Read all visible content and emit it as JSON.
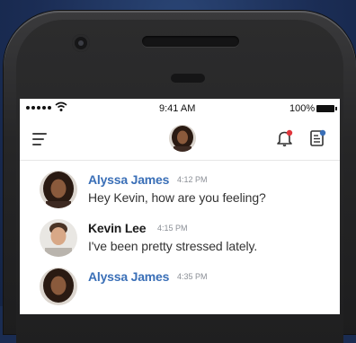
{
  "status_bar": {
    "time": "9:41 AM",
    "battery": "100%",
    "signal_icon": "signal-dots-icon",
    "wifi_icon": "wifi-icon",
    "battery_icon": "battery-icon"
  },
  "nav": {
    "menu_icon": "hamburger-icon",
    "avatar_icon": "avatar",
    "notification_icon": "bell-icon",
    "notes_icon": "notes-icon"
  },
  "colors": {
    "sender_blue": "#3a6fb7",
    "sender_dark": "#1b1b1b",
    "notification_dot": "#e0353b",
    "notes_dot": "#3a6fb7"
  },
  "messages": [
    {
      "name": "Alyssa James",
      "time": "4:12 PM",
      "text": "Hey Kevin, how are you feeling?"
    },
    {
      "name": "Kevin Lee",
      "time": "4:15 PM",
      "text": "I've been pretty stressed lately."
    },
    {
      "name": "Alyssa James",
      "time": "4:35 PM",
      "text": ""
    }
  ]
}
